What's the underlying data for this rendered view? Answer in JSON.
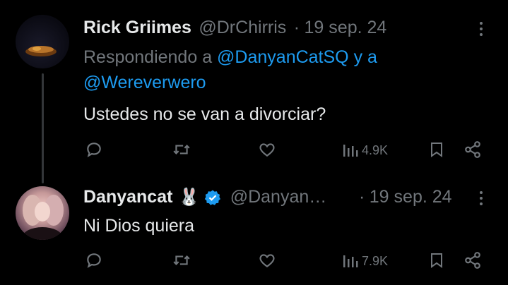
{
  "tweet1": {
    "author_name": "Rick Griimes",
    "handle": "@DrChirris",
    "separator": "·",
    "date": "19 sep. 24",
    "replying_prefix": "Respondiendo a",
    "replying_to_1": "@DanyanCatSQ",
    "replying_and": "y a",
    "replying_to_2": "@Wereverwero",
    "text": "Ustedes no se van a divorciar?",
    "views": "4.9K"
  },
  "tweet2": {
    "author_name": "Danyancat",
    "name_emoji": "🐰",
    "handle": "@Danyan…",
    "separator": "·",
    "date": "19 sep. 24",
    "text": "Ni Dios quiera",
    "views": "7.9K"
  },
  "colors": {
    "background": "#000000",
    "primary_text": "#e7e9ea",
    "secondary_text": "#71767b",
    "link": "#1d9bf0",
    "verified": "#1d9bf0"
  },
  "icons": [
    "reply-icon",
    "retweet-icon",
    "like-icon",
    "views-icon",
    "bookmark-icon",
    "share-icon",
    "more-icon",
    "verified-icon"
  ]
}
